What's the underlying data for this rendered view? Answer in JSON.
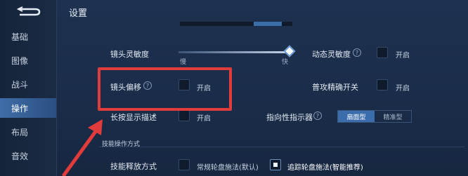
{
  "sidebar": {
    "items": [
      {
        "label": "基础"
      },
      {
        "label": "图像"
      },
      {
        "label": "战斗"
      },
      {
        "label": "操作",
        "active": true
      },
      {
        "label": "布局"
      },
      {
        "label": "音效"
      }
    ]
  },
  "header": {
    "title": "设置"
  },
  "camera_sensitivity": {
    "label": "镜头灵敏度",
    "min_label": "慢",
    "max_label": "快",
    "level": 1.0
  },
  "dynamic_sensitivity": {
    "label": "动态灵敏度",
    "option": "开启",
    "checked": false
  },
  "camera_offset": {
    "label": "镜头偏移",
    "option": "开启",
    "checked": false
  },
  "basic_attack": {
    "label": "普攻精确开关",
    "option": "开启",
    "checked": false
  },
  "long_press": {
    "label": "长按显示描述",
    "option": "开启",
    "checked": false
  },
  "indicator": {
    "label": "指向性指示器",
    "options": [
      "扇面型",
      "精准型"
    ],
    "selected": 0
  },
  "skill_section": {
    "title": "技能操作方式"
  },
  "skill_release": {
    "label": "技能释放方式",
    "option1": "常规轮盘施法(默认)",
    "option1_checked": false,
    "option2": "追踪轮盘施法(智能推荐)",
    "option2_checked": true
  },
  "colors": {
    "highlight": "#e23b3b",
    "accent": "#3b6cab"
  }
}
